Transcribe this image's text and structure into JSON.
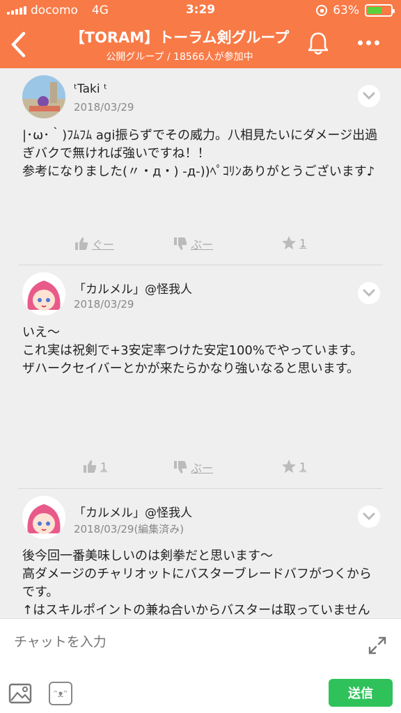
{
  "status": {
    "carrier": "docomo",
    "network": "4G",
    "time": "3:29",
    "battery": "63%",
    "battery_level": 0.63
  },
  "header": {
    "title": "【TORAM】トーラム剣グループ",
    "subtitle": "公開グループ / 18566人が参加中",
    "bg_color": "#f87a47"
  },
  "messages": [
    {
      "author": "ᵗTaki ᵗ",
      "date": "2018/03/29",
      "text": "|･ω･｀)ﾌﾑﾌﾑ agi振らずでその威力。八相見たいにダメージ出過ぎバクで無ければ強いですね！！\n参考になりました(〃・д・) -д-))ﾍﾟｺﾘﾝありがとうございます♪",
      "like": "ぐー",
      "dislike": "ぶー",
      "star": "1"
    },
    {
      "author": "「カルメル」@怪我人",
      "date": "2018/03/29",
      "text": "いえ〜\nこれ実は祝剣で+3安定率つけた安定100%でやっています。\nザハークセイバーとかが来たらかなり強いなると思います。",
      "like": "1",
      "dislike": "ぶー",
      "star": "1"
    },
    {
      "author": "「カルメル」@怪我人",
      "date": "2018/03/29(編集済み)",
      "text": "後今回一番美味しいのは剣拳だと思います〜\n高ダメージのチャリオットにバスターブレードバフがつくからです。\n↑はスキルポイントの兼ね合いからバスターは取っていませんがバスターバフ中のチャリオットはかなり強"
    }
  ],
  "composer": {
    "placeholder": "チャットを入力",
    "send_label": "送信",
    "emoji_face": "ᵔᴥᵔ",
    "send_color": "#2fc25b"
  }
}
